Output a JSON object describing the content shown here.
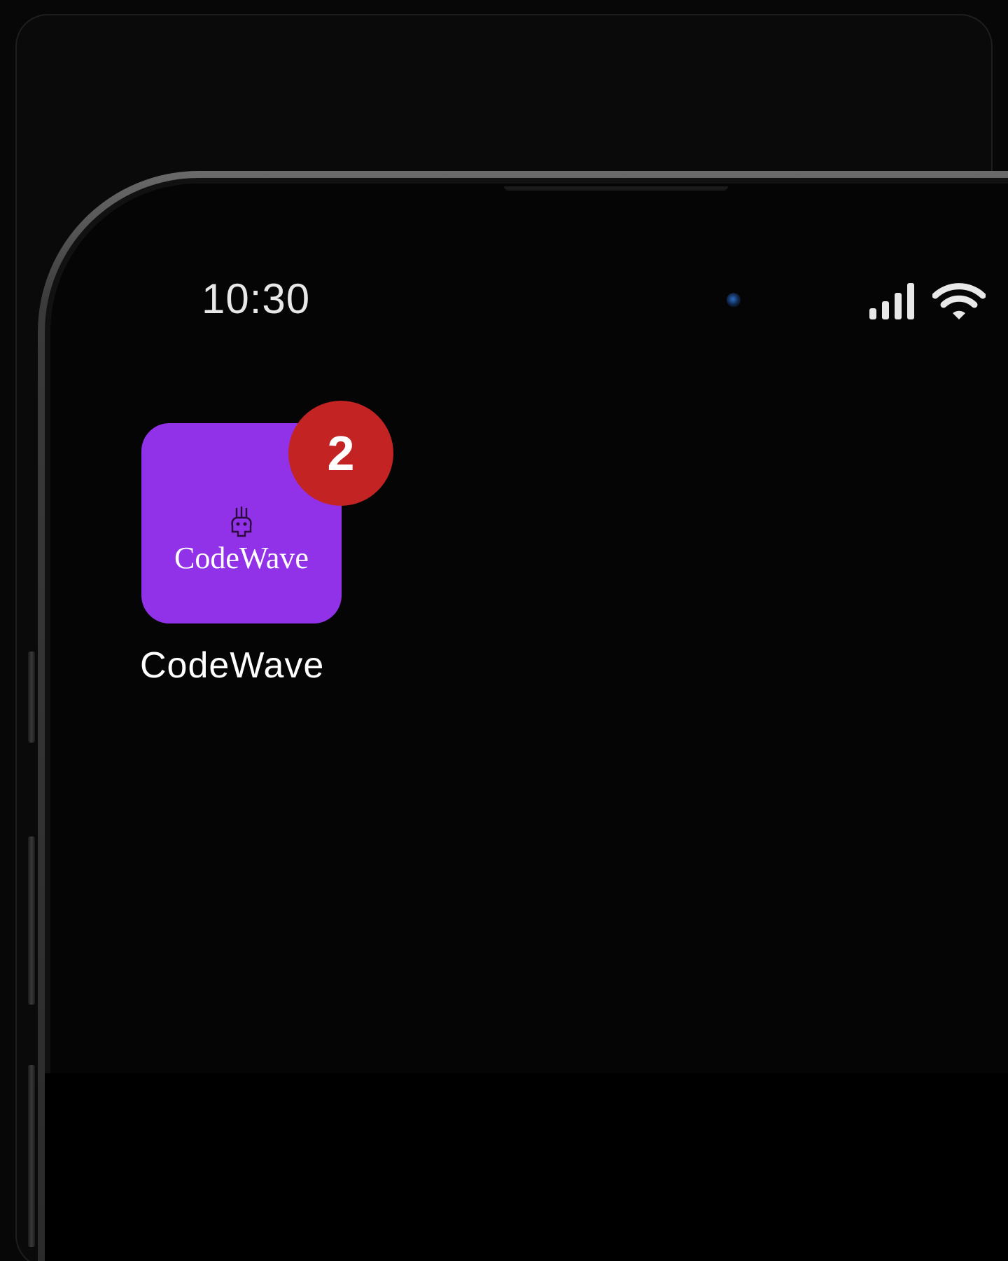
{
  "status_bar": {
    "time": "10:30",
    "signal_icon": "cellular-signal-icon",
    "wifi_icon": "wifi-icon"
  },
  "home_screen": {
    "apps": [
      {
        "label": "CodeWave",
        "icon_text": "CodeWave",
        "icon_color": "#9131e8",
        "badge_count": "2",
        "badge_color": "#c42323"
      }
    ]
  }
}
